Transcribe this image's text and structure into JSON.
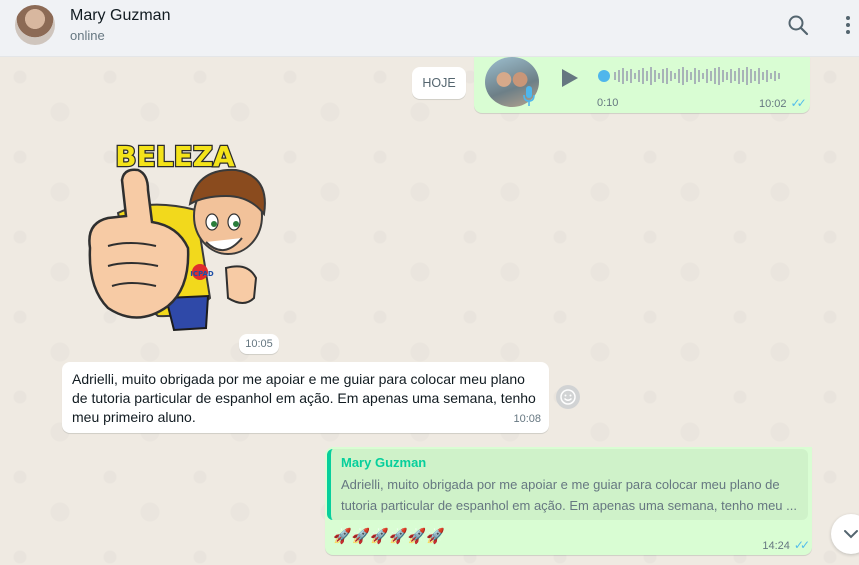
{
  "header": {
    "contact_name": "Mary Guzman",
    "status": "online",
    "icons": [
      "search-icon",
      "menu-icon"
    ]
  },
  "date_chip": "HOJE",
  "audio_message": {
    "duration": "0:10",
    "time": "10:02",
    "ticks": "✓✓"
  },
  "sticker": {
    "text": "BELEZA",
    "badge": "ICPAD",
    "time": "10:05"
  },
  "incoming_message": {
    "line1": "Adrielli, muito obrigada por me apoiar e me guiar para colocar meu plano",
    "line2": "de tutoria particular de espanhol em ação. Em apenas uma semana, tenho",
    "line3": "meu primeiro aluno.",
    "time": "10:08"
  },
  "reply_message": {
    "quoted_author": "Mary Guzman",
    "quoted_line1": "Adrielli, muito obrigada por me apoiar e me guiar para colocar meu plano de",
    "quoted_line2": "tutoria particular de espanhol em ação. Em apenas uma semana, tenho meu ...",
    "text": "🚀🚀🚀🚀🚀🚀",
    "time": "14:24",
    "ticks": "✓✓"
  },
  "colors": {
    "outgoing_bubble": "#d9fdd3",
    "accent": "#06cf9c",
    "read_ticks": "#53bdeb"
  }
}
